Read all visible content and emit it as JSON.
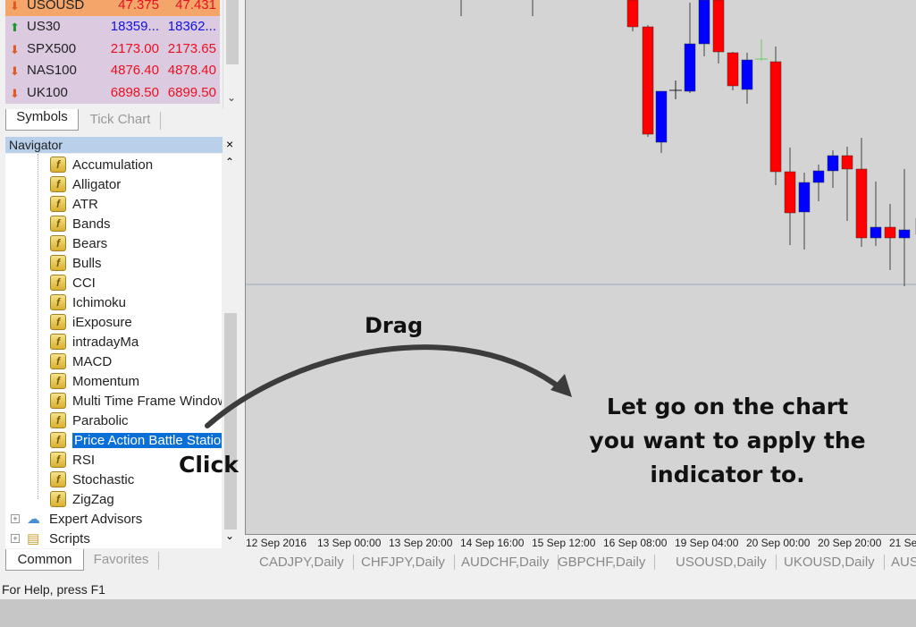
{
  "market_watch": {
    "rows": [
      {
        "symbol": "USOUSD",
        "bid": "47.375",
        "ask": "47.431",
        "direction": "down",
        "selected": true
      },
      {
        "symbol": "US30",
        "bid": "18359...",
        "ask": "18362...",
        "direction": "up"
      },
      {
        "symbol": "SPX500",
        "bid": "2173.00",
        "ask": "2173.65",
        "direction": "down"
      },
      {
        "symbol": "NAS100",
        "bid": "4876.40",
        "ask": "4878.40",
        "direction": "down"
      },
      {
        "symbol": "UK100",
        "bid": "6898.50",
        "ask": "6899.50",
        "direction": "down"
      }
    ],
    "tabs": [
      "Symbols",
      "Tick Chart"
    ],
    "up_color": "#1010e0",
    "down_color": "#e81020"
  },
  "navigator": {
    "title": "Navigator",
    "close": "×",
    "indicators": [
      "Accumulation",
      "Alligator",
      "ATR",
      "Bands",
      "Bears",
      "Bulls",
      "CCI",
      "Ichimoku",
      "iExposure",
      "intradayMa",
      "MACD",
      "Momentum",
      "Multi Time Frame Window",
      "Parabolic",
      "Price Action Battle Station",
      "RSI",
      "Stochastic",
      "ZigZag"
    ],
    "selected": "Price Action Battle Station",
    "groups": [
      "Expert Advisors",
      "Scripts"
    ],
    "tabs": [
      "Common",
      "Favorites"
    ]
  },
  "chart": {
    "time_axis": [
      "12 Sep 2016",
      "13 Sep 00:00",
      "13 Sep 20:00",
      "14 Sep 16:00",
      "15 Sep 12:00",
      "16 Sep 08:00",
      "19 Sep 04:00",
      "20 Sep 00:00",
      "20 Sep 20:00",
      "21 Se"
    ],
    "tabs": [
      "CADJPY,Daily",
      "CHFJPY,Daily",
      "AUDCHF,Daily",
      "GBPCHF,Daily",
      "USOUSD,Daily",
      "UKOUSD,Daily",
      "AUS"
    ],
    "bull_color": "#0000ff",
    "bear_color": "#ff0000"
  },
  "annotations": {
    "drag": "Drag",
    "click": "Click",
    "instruction": [
      "Let go on the chart",
      "you want to apply the",
      "indicator to."
    ]
  },
  "status": "For Help, press F1"
}
